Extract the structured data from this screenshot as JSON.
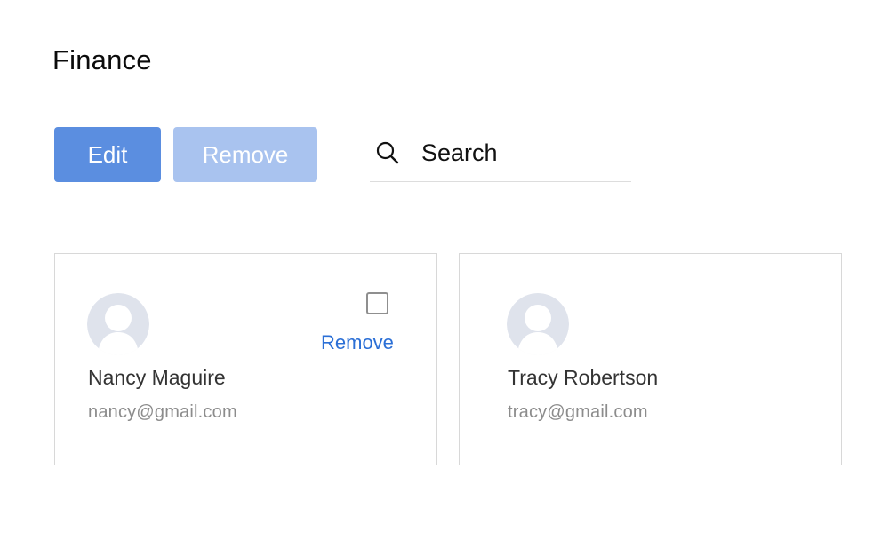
{
  "page": {
    "title": "Finance"
  },
  "toolbar": {
    "edit_label": "Edit",
    "remove_label": "Remove"
  },
  "search": {
    "placeholder": "Search",
    "icon": "search-icon"
  },
  "members": [
    {
      "name": "Nancy Maguire",
      "email": "nancy@gmail.com",
      "selected": false,
      "remove_label": "Remove",
      "avatar": "person-placeholder-icon"
    },
    {
      "name": "Tracy Robertson",
      "email": "tracy@gmail.com",
      "avatar": "person-placeholder-icon"
    }
  ],
  "colors": {
    "primary": "#5b8ee0",
    "primary_disabled": "#a9c3ef",
    "link": "#2b6fd6",
    "avatar": "#dfe3ec",
    "card_border": "#d8d8d8"
  }
}
